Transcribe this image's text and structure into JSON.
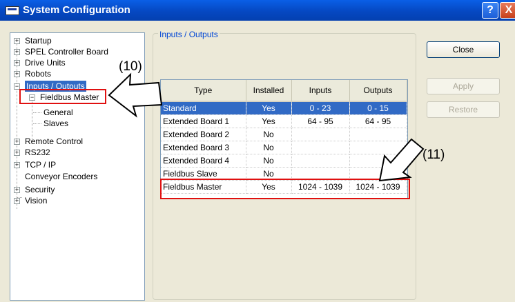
{
  "window": {
    "title": "System Configuration",
    "help_label": "?",
    "close_label": "X"
  },
  "tree": {
    "items": [
      {
        "label": "Startup",
        "expander": "+"
      },
      {
        "label": "SPEL Controller Board",
        "expander": "+"
      },
      {
        "label": "Drive Units",
        "expander": "+"
      },
      {
        "label": "Robots",
        "expander": "+"
      },
      {
        "label": "Inputs / Outputs",
        "expander": "−"
      },
      {
        "label": "Fieldbus Master",
        "expander": "−"
      },
      {
        "label": "General"
      },
      {
        "label": "Slaves"
      },
      {
        "label": "Remote Control",
        "expander": "+"
      },
      {
        "label": "RS232",
        "expander": "+"
      },
      {
        "label": "TCP / IP",
        "expander": "+"
      },
      {
        "label": "Conveyor Encoders"
      },
      {
        "label": "Security",
        "expander": "+"
      },
      {
        "label": "Vision",
        "expander": "+"
      }
    ]
  },
  "panel": {
    "title": "Inputs / Outputs"
  },
  "table": {
    "headers": [
      "Type",
      "Installed",
      "Inputs",
      "Outputs"
    ],
    "rows": [
      [
        "Standard",
        "Yes",
        "0 - 23",
        "0 - 15"
      ],
      [
        "Extended Board 1",
        "Yes",
        "64 - 95",
        "64 - 95"
      ],
      [
        "Extended Board 2",
        "No",
        "",
        ""
      ],
      [
        "Extended Board 3",
        "No",
        "",
        ""
      ],
      [
        "Extended Board 4",
        "No",
        "",
        ""
      ],
      [
        "Fieldbus Slave",
        "No",
        "",
        ""
      ],
      [
        "Fieldbus Master",
        "Yes",
        "1024 - 1039",
        "1024 - 1039"
      ]
    ]
  },
  "buttons": {
    "close": "Close",
    "apply": "Apply",
    "restore": "Restore"
  },
  "annotations": {
    "label_10": "(10)",
    "label_11": "(11)"
  },
  "colors": {
    "selection": "#316ac5",
    "title_bar": "#0548c2",
    "highlight_box": "#e01010"
  }
}
